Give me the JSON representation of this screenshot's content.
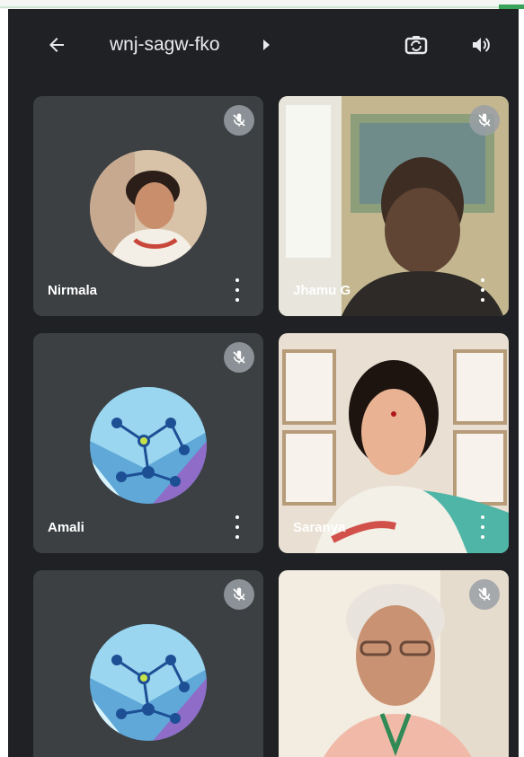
{
  "meeting": {
    "code": "wnj-sagw-fko"
  },
  "icons": {
    "back": "arrow-left-icon",
    "info": "caret-right-icon",
    "switch_camera": "switch-camera-icon",
    "audio": "speaker-icon",
    "muted": "mic-off-icon",
    "more": "more-vert-icon"
  },
  "participants": [
    {
      "name": "Nirmala",
      "muted": true,
      "view": "avatar-photo"
    },
    {
      "name": "Jhamu G",
      "muted": true,
      "view": "camera"
    },
    {
      "name": "Amali",
      "muted": true,
      "view": "avatar-molecule"
    },
    {
      "name": "Saranya",
      "muted": false,
      "view": "camera"
    },
    {
      "name": "",
      "muted": true,
      "view": "avatar-molecule"
    },
    {
      "name": "",
      "muted": true,
      "view": "camera"
    }
  ],
  "colors": {
    "background": "#202124",
    "tile": "#3c4043",
    "text": "#e8eaed",
    "mute_badge": "#9aa0a6"
  }
}
